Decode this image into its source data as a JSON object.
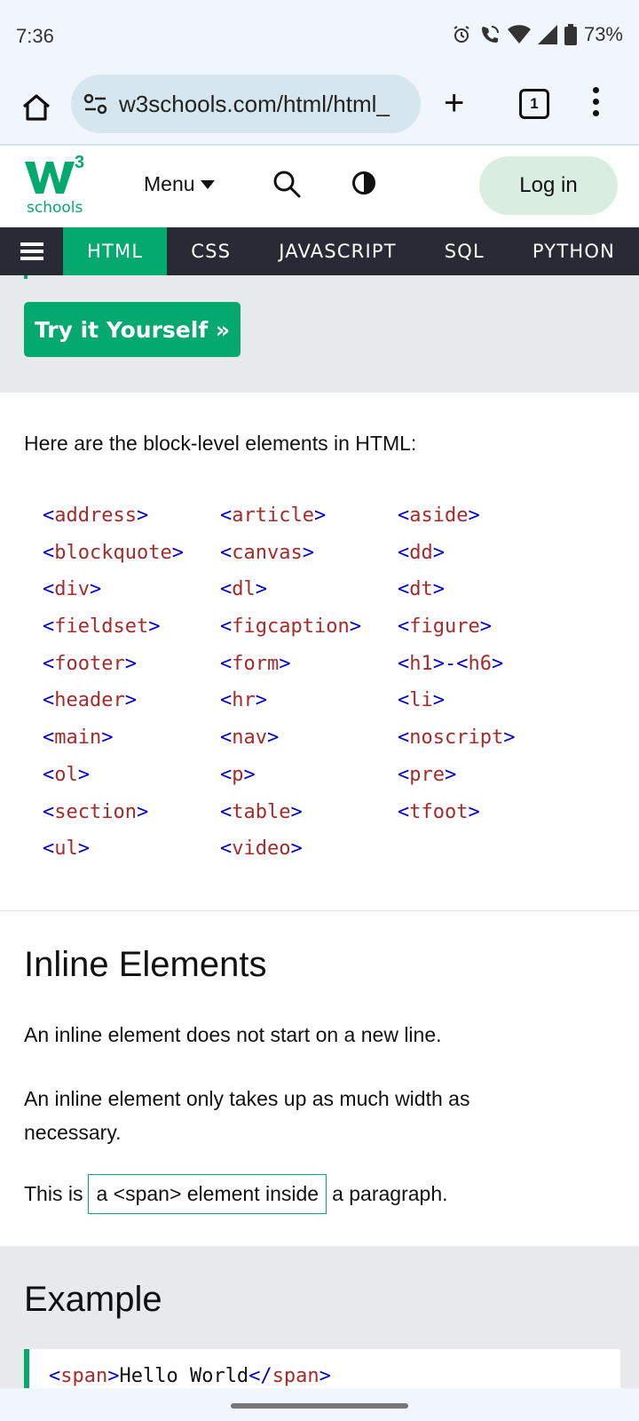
{
  "status_bar": {
    "time": "7:36",
    "battery": "73%",
    "icons": [
      "alarm-icon",
      "wifi-call-icon",
      "wifi-icon",
      "signal-icon",
      "battery-icon"
    ]
  },
  "browser": {
    "url": "w3schools.com/html/html_",
    "tab_count": "1"
  },
  "site_header": {
    "logo_sup": "3",
    "logo_text": "schools",
    "menu_label": "Menu",
    "login_label": "Log in"
  },
  "topnav": {
    "items": [
      "HTML",
      "CSS",
      "JAVASCRIPT",
      "SQL",
      "PYTHON"
    ],
    "active": "HTML"
  },
  "try_button": "Try it Yourself »",
  "block_intro": "Here are the block-level elements in HTML:",
  "block_elements": [
    [
      "<",
      "address",
      ">"
    ],
    [
      "<",
      "article",
      ">"
    ],
    [
      "<",
      "aside",
      ">"
    ],
    [
      "<",
      "blockquote",
      ">"
    ],
    [
      "<",
      "canvas",
      ">"
    ],
    [
      "<",
      "dd",
      ">"
    ],
    [
      "<",
      "div",
      ">"
    ],
    [
      "<",
      "dl",
      ">"
    ],
    [
      "<",
      "dt",
      ">"
    ],
    [
      "<",
      "fieldset",
      ">"
    ],
    [
      "<",
      "figcaption",
      ">"
    ],
    [
      "<",
      "figure",
      ">"
    ],
    [
      "<",
      "footer",
      ">"
    ],
    [
      "<",
      "form",
      ">"
    ],
    [
      "<",
      "h1",
      ">-<",
      "h6",
      ">"
    ],
    [
      "<",
      "header",
      ">"
    ],
    [
      "<",
      "hr",
      ">"
    ],
    [
      "<",
      "li",
      ">"
    ],
    [
      "<",
      "main",
      ">"
    ],
    [
      "<",
      "nav",
      ">"
    ],
    [
      "<",
      "noscript",
      ">"
    ],
    [
      "<",
      "ol",
      ">"
    ],
    [
      "<",
      "p",
      ">"
    ],
    [
      "<",
      "pre",
      ">"
    ],
    [
      "<",
      "section",
      ">"
    ],
    [
      "<",
      "table",
      ">"
    ],
    [
      "<",
      "tfoot",
      ">"
    ],
    [
      "<",
      "ul",
      ">"
    ],
    [
      "<",
      "video",
      ">"
    ]
  ],
  "inline_section": {
    "title": "Inline Elements",
    "p1": "An inline element does not start on a new line.",
    "p2": "An inline element only takes up as much width as necessary.",
    "p3_before": "This is",
    "p3_span": "a <span> element inside",
    "p3_after": "a paragraph."
  },
  "example": {
    "title": "Example",
    "code_open_lt": "<",
    "code_open_tag": "span",
    "code_open_gt": ">",
    "code_text": "Hello World",
    "code_close_lt": "</",
    "code_close_tag": "span",
    "code_close_gt": ">"
  },
  "colors": {
    "brand_green": "#04aa6d",
    "nav_dark": "#282a35",
    "tag_blue": "#0000cd",
    "tag_name": "#a52a2a"
  }
}
